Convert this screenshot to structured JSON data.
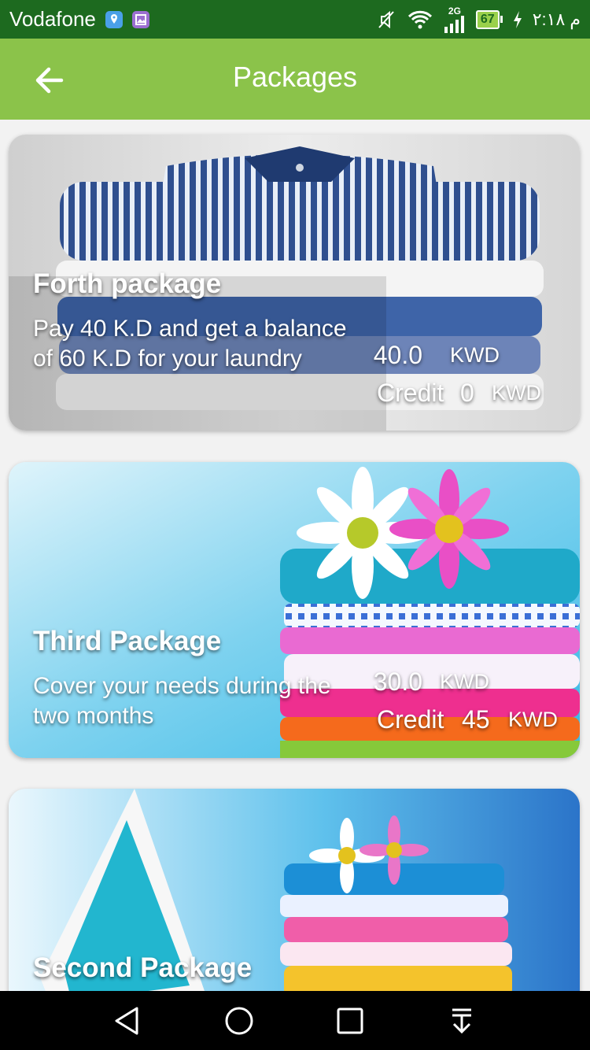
{
  "status_bar": {
    "carrier": "Vodafone",
    "network": "2G",
    "battery": "67",
    "time": "م ٢:١٨",
    "icons": [
      "location-icon",
      "gallery-icon",
      "mute-icon",
      "wifi-icon",
      "signal-icon",
      "battery-icon",
      "charging-icon"
    ]
  },
  "app_bar": {
    "title": "Packages",
    "back_icon": "arrow-left-icon"
  },
  "packages": [
    {
      "name": "Forth package",
      "description": "Pay 40 K.D and get a balance of 60 K.D for your laundry",
      "price": "40.0",
      "currency": "KWD",
      "credit_label": "Credit",
      "credit_value": "0",
      "credit_currency": "KWD"
    },
    {
      "name": "Third Package",
      "description": "Cover your needs during the two months",
      "price": "30.0",
      "currency": "KWD",
      "credit_label": "Credit",
      "credit_value": "45",
      "credit_currency": "KWD"
    },
    {
      "name": "Second Package"
    }
  ],
  "nav_bar": {
    "buttons": [
      "back-triangle-icon",
      "home-circle-icon",
      "recents-square-icon",
      "notification-pull-icon"
    ]
  },
  "colors": {
    "status_bar": "#1d6a1f",
    "app_bar": "#8bc34a",
    "background": "#f2f2f2"
  }
}
